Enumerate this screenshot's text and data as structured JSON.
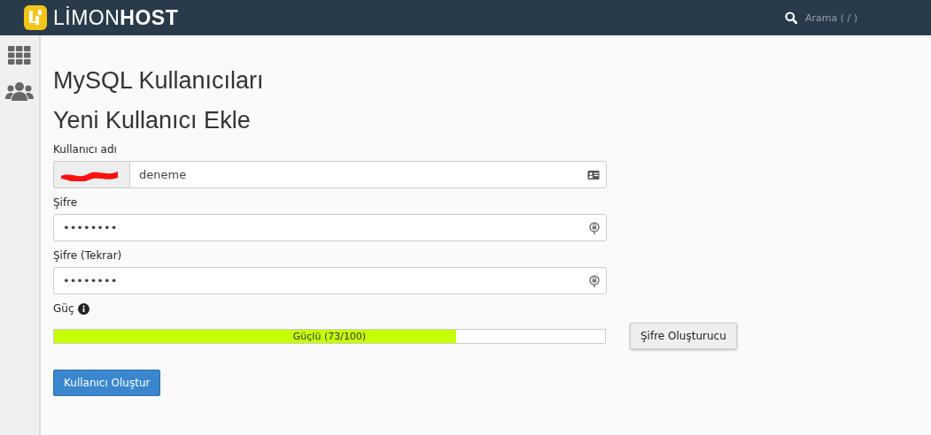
{
  "header": {
    "logo_text_light": "LİMON",
    "logo_text_bold": "HOST",
    "search": {
      "placeholder": "Arama ( / )"
    }
  },
  "page_title": "MySQL Kullanıcıları",
  "section_title": "Yeni Kullanıcı Ekle",
  "fields": [
    {
      "label": "Kullanıcı adı",
      "kind": "username",
      "value": "deneme",
      "prefix_redacted": true
    },
    {
      "label": "Şifre",
      "kind": "password",
      "value": "••••••••"
    },
    {
      "label": "Şifre (Tekrar)",
      "kind": "password",
      "value": "••••••••"
    }
  ],
  "strength": {
    "label": "Güç",
    "level": 0.73,
    "reading": "Güçlü (73/100)"
  },
  "generator_button": "Şifre Oluşturucu",
  "submit_button": "Kullanıcı Oluştur"
}
